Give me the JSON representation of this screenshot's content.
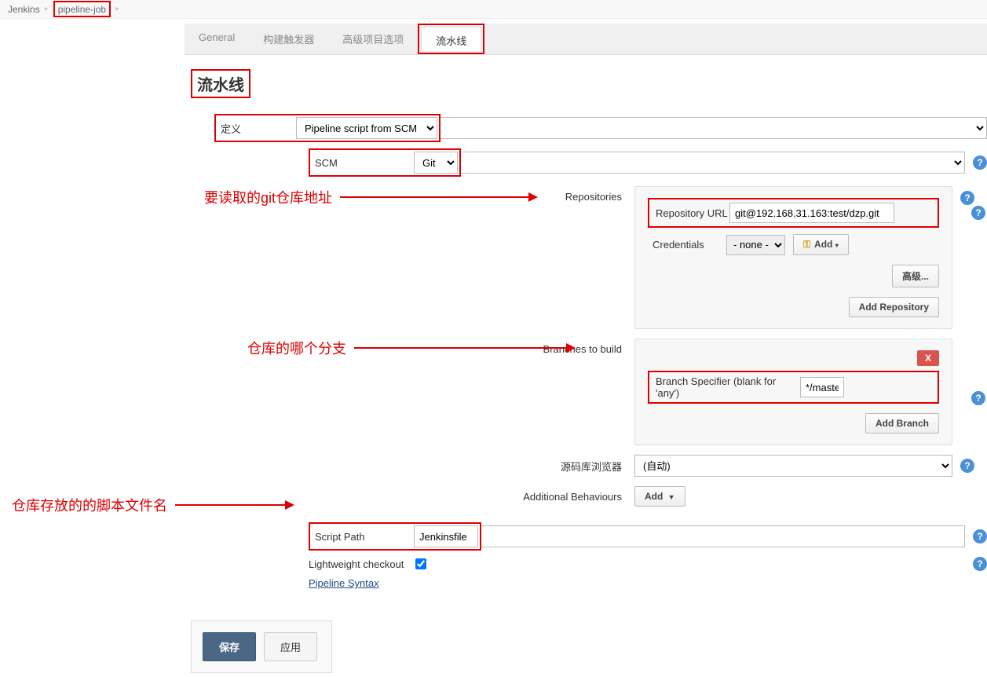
{
  "breadcrumb": {
    "root": "Jenkins",
    "job": "pipeline-job"
  },
  "tabs": {
    "general": "General",
    "triggers": "构建触发器",
    "advanced": "高级项目选项",
    "pipeline": "流水线"
  },
  "section_title": "流水线",
  "definition": {
    "label": "定义",
    "value": "Pipeline script from SCM"
  },
  "scm": {
    "label": "SCM",
    "value": "Git"
  },
  "repositories": {
    "label": "Repositories",
    "url_label": "Repository URL",
    "url_value": "git@192.168.31.163:test/dzp.git",
    "credentials_label": "Credentials",
    "credentials_value": "- none -",
    "add_btn": "Add",
    "advanced_btn": "高级...",
    "add_repo_btn": "Add Repository"
  },
  "branches": {
    "label": "Branches to build",
    "spec_label": "Branch Specifier (blank for 'any')",
    "spec_value": "*/master",
    "delete": "X",
    "add_branch": "Add Branch"
  },
  "browser": {
    "label": "源码库浏览器",
    "value": "(自动)"
  },
  "additional": {
    "label": "Additional Behaviours",
    "add_btn": "Add"
  },
  "script_path": {
    "label": "Script Path",
    "value": "Jenkinsfile"
  },
  "lightweight": {
    "label": "Lightweight checkout",
    "checked": true
  },
  "pipeline_syntax": "Pipeline Syntax",
  "footer": {
    "save": "保存",
    "apply": "应用"
  },
  "annotations": {
    "repo_url": "要读取的git仓库地址",
    "branch": "仓库的哪个分支",
    "script": "仓库存放的的脚本文件名"
  }
}
